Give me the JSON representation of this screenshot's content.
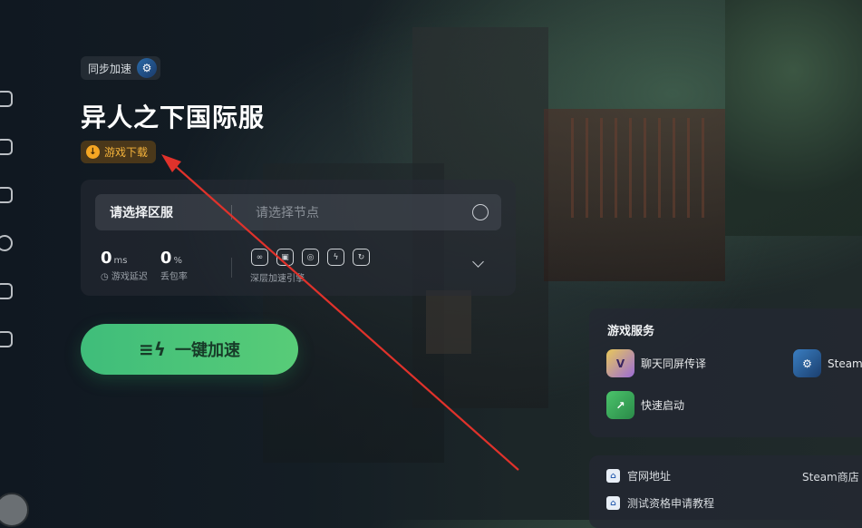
{
  "header": {
    "sync_label": "同步加速",
    "title": "异人之下国际服",
    "download_label": "游戏下载"
  },
  "server_panel": {
    "region_label": "请选择区服",
    "node_placeholder": "请选择节点",
    "latency": {
      "value": "0",
      "unit": "ms",
      "label": "游戏延迟"
    },
    "packet_loss": {
      "value": "0",
      "unit": "%",
      "label": "丢包率"
    },
    "tools_label": "深层加速引擎"
  },
  "accelerate": {
    "label": "一键加速"
  },
  "services": {
    "title": "游戏服务",
    "items": [
      {
        "label": "聊天同屏传译",
        "icon": "translate-icon"
      },
      {
        "label": "Steam",
        "icon": "steam-icon"
      },
      {
        "label": "快速启动",
        "icon": "quick-launch-icon"
      }
    ]
  },
  "links": {
    "items": [
      {
        "label": "官网地址"
      },
      {
        "label": "测试资格申请教程"
      }
    ],
    "right_label": "Steam商店"
  },
  "colors": {
    "accent_green": "#4cc47a",
    "download_orange": "#f5a623",
    "annotation_red": "#e0322b"
  }
}
